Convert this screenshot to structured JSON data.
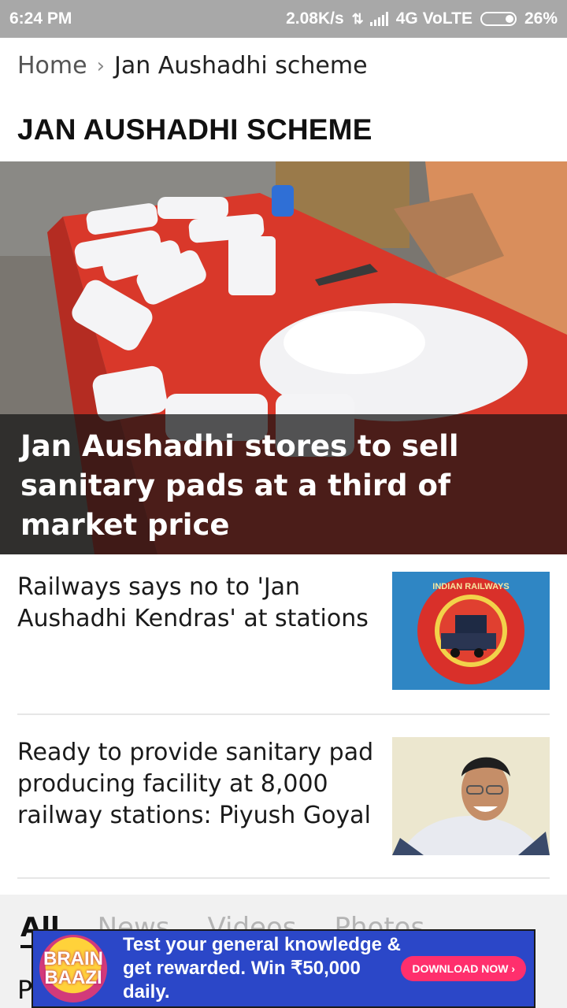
{
  "status_bar": {
    "time": "6:24 PM",
    "speed": "2.08K/s",
    "network": "4G VoLTE",
    "battery": "26%"
  },
  "breadcrumb": {
    "home": "Home",
    "separator": "›",
    "current": "Jan Aushadhi scheme"
  },
  "page_title": "JAN AUSHADHI SCHEME",
  "hero": {
    "headline": "Jan Aushadhi stores to sell sanitary pads at a third of market price"
  },
  "stories": [
    {
      "title": "Railways says no to 'Jan Aushadhi Kendras' at stations",
      "thumb_label": "INDIAN RAILWAYS"
    },
    {
      "title": "Ready to provide sanitary pad producing facility at 8,000 railway stations: Piyush Goyal"
    }
  ],
  "tabs": [
    "All",
    "News",
    "Videos",
    "Photos"
  ],
  "list_peek_text": "P",
  "ad": {
    "logo_line1": "BRAIN",
    "logo_line2": "BAAZI",
    "line1": "Test your general knowledge &",
    "line2": "get rewarded. Win ₹50,000 daily.",
    "cta": "DOWNLOAD NOW ›"
  }
}
